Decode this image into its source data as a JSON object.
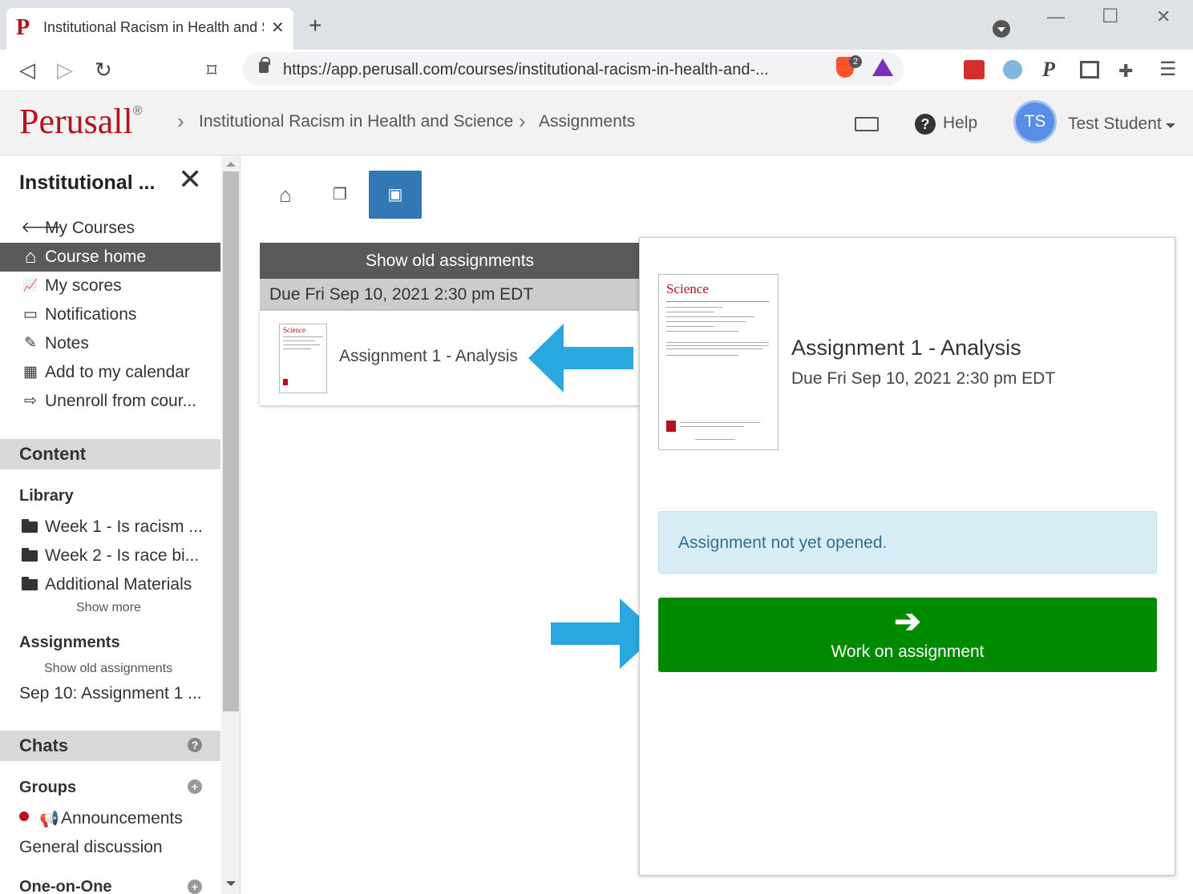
{
  "browser": {
    "tab_favicon": "P",
    "tab_title": "Institutional Racism in Health and Science",
    "tab_close": "✕",
    "new_tab": "+",
    "url": "https://app.perusall.com/courses/institutional-racism-in-health-and-...",
    "brave_count": "2",
    "window_minimize": "—",
    "window_maximize": "☐",
    "window_close": "✕"
  },
  "header": {
    "logo": "Perusall",
    "logo_mark": "®",
    "breadcrumb": [
      "Institutional Racism in Health and Science",
      "Assignments"
    ],
    "help_label": "Help",
    "user_initials": "TS",
    "user_name": "Test Student"
  },
  "sidebar": {
    "title": "Institutional ...",
    "close": "✕",
    "nav": [
      {
        "label": "My Courses",
        "icon": "arrow-left-icon",
        "glyph": "🡐"
      },
      {
        "label": "Course home",
        "icon": "home-icon",
        "glyph": "⌂"
      },
      {
        "label": "My scores",
        "icon": "line-chart-icon",
        "glyph": "📈"
      },
      {
        "label": "Notifications",
        "icon": "inbox-icon",
        "glyph": "▭"
      },
      {
        "label": "Notes",
        "icon": "pencil-icon",
        "glyph": "✎"
      },
      {
        "label": "Add to my calendar",
        "icon": "calendar-icon",
        "glyph": "▦"
      },
      {
        "label": "Unenroll from cour...",
        "icon": "sign-out-icon",
        "glyph": "⇨"
      }
    ],
    "content_header": "Content",
    "library_label": "Library",
    "library_items": [
      "Week 1 - Is racism ...",
      "Week 2 - Is race bi...",
      "Additional Materials"
    ],
    "show_more": "Show more",
    "assignments_label": "Assignments",
    "show_old_assignments": "Show old assignments",
    "assignment_item": "Sep 10: Assignment 1 ...",
    "chats_header": "Chats",
    "groups_label": "Groups",
    "announcements": "Announcements",
    "general_discussion": "General discussion",
    "one_on_one": "One-on-One"
  },
  "toolbar": {
    "home_icon": "⌂",
    "documents_icon": "❐",
    "calendar_icon": "▣"
  },
  "assignments": {
    "show_old": "Show old assignments",
    "due_group": "Due Fri Sep 10, 2021 2:30 pm EDT",
    "items": [
      {
        "title": "Assignment 1 - Analysis"
      }
    ]
  },
  "detail": {
    "thumbnail_brand": "Science",
    "title": "Assignment 1 - Analysis",
    "due": "Due Fri Sep 10, 2021 2:30 pm EDT",
    "status": "Assignment not yet opened.",
    "work_icon": "➔",
    "work_label": "Work on assignment"
  },
  "colors": {
    "brand": "#b5121b",
    "active_tab": "#3477b5",
    "success": "#008a00",
    "info_bg": "#d9edf7",
    "annotation_arrow": "#29a8df"
  }
}
